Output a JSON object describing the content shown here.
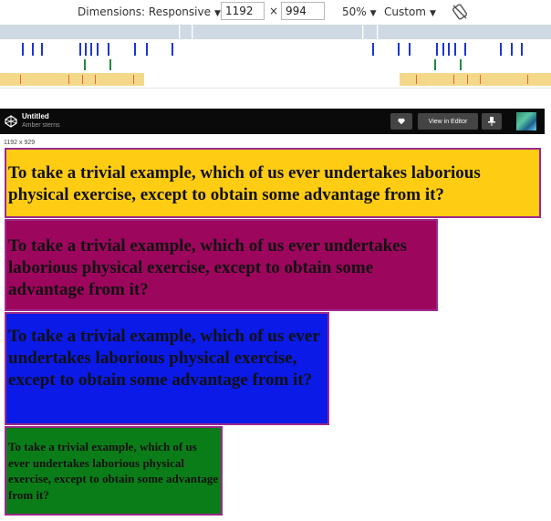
{
  "toolbar": {
    "dimensions_label": "Dimensions: Responsive",
    "width_value": "1192",
    "times_symbol": "×",
    "height_value": "994",
    "zoom_label": "50%",
    "throttle_label": "Custom",
    "caret": "▼"
  },
  "codepen": {
    "title": "Untitled",
    "author": "Amber sterns",
    "view_in_editor_label": "View in Editor",
    "heart_icon": "heart-icon",
    "pin_icon": "pin-icon"
  },
  "viewport_size_label": "1192 x 929",
  "boxes": [
    {
      "text": "To take a trivial example, which of us ever undertakes laborious physical exercise, except to obtain some advantage from it?",
      "color": "#ffcc14"
    },
    {
      "text": "To take a trivial example, which of us ever undertakes laborious physical exercise, except to obtain some advantage from it?",
      "color": "#9d065d"
    },
    {
      "text": "To take a trivial example, which of us ever undertakes laborious physical exercise, except to obtain some advantage from it?",
      "color": "#0b1ae6"
    },
    {
      "text": "To take a trivial example, which of us ever undertakes laborious physical exercise, except to obtain some advantage from it?",
      "color": "#0b7d18"
    }
  ],
  "colors": {
    "box_border": "#9b2a8c",
    "media_query_blue": "#1a35d6",
    "media_query_green": "#1f8a3a",
    "media_query_yellow": "#f4d88a"
  }
}
